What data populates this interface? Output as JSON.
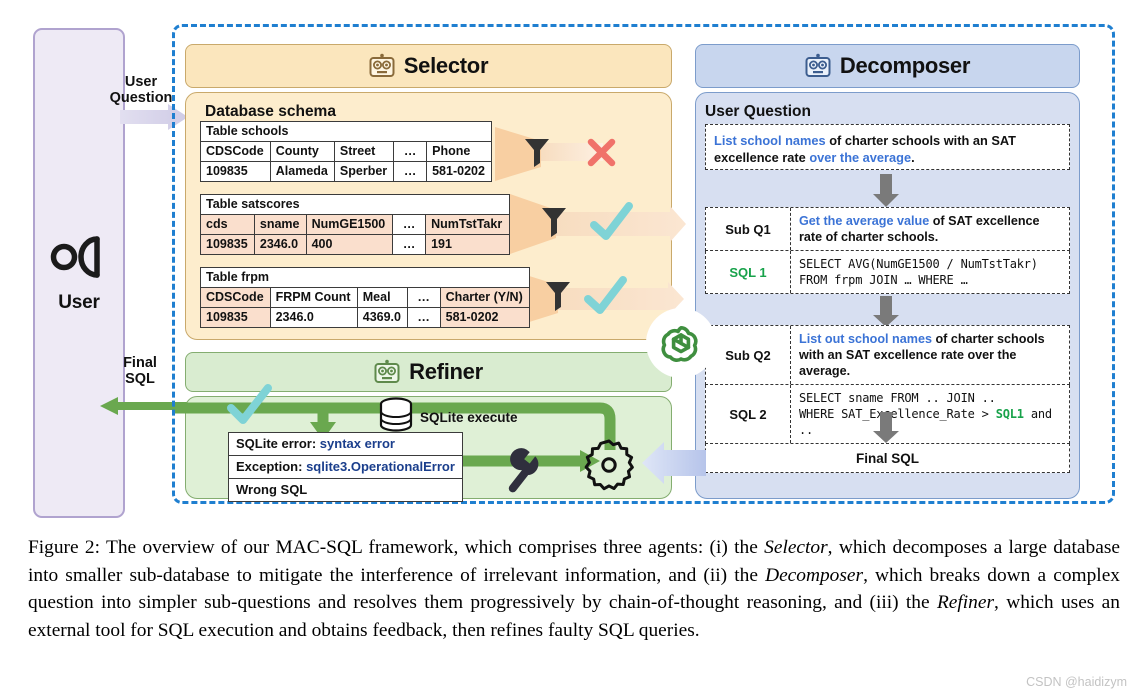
{
  "colors": {
    "framework_border": "#1f7fd0",
    "selector_bg": "#fdedcd",
    "selector_head_bg": "#fbe6bd",
    "decomposer_bg": "#d7dff1",
    "decomposer_head_bg": "#c8d6ee",
    "refiner_bg": "#dff0d6",
    "refiner_head_bg": "#d9ecd0",
    "user_bg": "#eeeaf5",
    "accent_green": "#6aa84f",
    "accent_blue": "#3b73d6",
    "check_teal": "#7fd3d6",
    "cross_red": "#f0726a",
    "sql_green": "#17a24a",
    "row_shade": "#fadfcd",
    "openai_green": "#3f8f3f"
  },
  "user": {
    "label": "User",
    "icon": "person-icon",
    "question_flow_label": "User\nQuestion",
    "question_flow_label_line1": "User",
    "question_flow_label_line2": "Question",
    "final_flow_label_line1": "Final",
    "final_flow_label_line2": "SQL"
  },
  "selector": {
    "title": "Selector",
    "icon": "robot-icon",
    "panel_title": "Database schema",
    "tables": [
      {
        "name": "Table schools",
        "shaded": false,
        "headers": [
          "CDSCode",
          "County",
          "Street",
          "…",
          "Phone"
        ],
        "row": [
          "109835",
          "Alameda",
          "Sperber",
          "…",
          "581-0202"
        ],
        "verdict": "cross",
        "shaded_cols": []
      },
      {
        "name": "Table satscores",
        "shaded": true,
        "headers": [
          "cds",
          "sname",
          "NumGE1500",
          "…",
          "NumTstTakr"
        ],
        "row": [
          "109835",
          "2346.0",
          "400",
          "…",
          "191"
        ],
        "verdict": "check",
        "shaded_cols": [
          0,
          1,
          2,
          4
        ]
      },
      {
        "name": "Table frpm",
        "shaded": true,
        "headers": [
          "CDSCode",
          "FRPM Count",
          "Meal",
          "…",
          "Charter (Y/N)"
        ],
        "row": [
          "109835",
          "2346.0",
          "4369.0",
          "…",
          "581-0202"
        ],
        "verdict": "check",
        "shaded_cols": [
          0,
          4
        ]
      }
    ],
    "filter_icon": "funnel-icon"
  },
  "decomposer": {
    "title": "Decomposer",
    "icon": "robot-icon",
    "panel_title": "User Question",
    "user_question": {
      "part1": "List school names",
      "part2": " of charter schools with an SAT excellence rate ",
      "part3": "over the average",
      "part4": "."
    },
    "steps": [
      {
        "label": "Sub Q1",
        "label_color": "black",
        "text_hl": "Get the average value",
        "text_rest": " of SAT excellence rate of charter schools."
      },
      {
        "label": "SQL 1",
        "label_color": "green",
        "code_line1": "SELECT AVG(NumGE1500 / NumTstTakr)",
        "code_line2": "FROM frpm JOIN … WHERE …"
      },
      {
        "label": "Sub Q2",
        "label_color": "black",
        "text_hl": "List out school names",
        "text_rest": " of charter schools with an SAT excellence rate over the average."
      },
      {
        "label": "SQL 2",
        "label_color": "black",
        "code_line1": "SELECT sname FROM .. JOIN ..",
        "code_line2_a": "WHERE SAT_Excellence_Rate > ",
        "code_line2_b": "SQL1",
        "code_line2_c": " and .."
      }
    ],
    "final_sql_label": "Final SQL"
  },
  "refiner": {
    "title": "Refiner",
    "icon": "robot-icon",
    "sqlite_execute_label": "SQLite execute",
    "db_icon": "database-icon",
    "gear_icon": "gear-icon",
    "wrench_icon": "wrench-icon",
    "errors": [
      {
        "key": "SQLite error:",
        "value": " syntax error"
      },
      {
        "key": "Exception:",
        "value": " sqlite3.OperationalError"
      },
      {
        "key": "Wrong SQL",
        "value": ""
      }
    ]
  },
  "caption": {
    "prefix": "Figure 2:",
    "text_1": " The overview of our MAC-SQL framework, which comprises three agents: (i) the ",
    "em_1": "Selector",
    "text_2": ", which decomposes a large database into smaller sub-database to mitigate the interference of irrelevant information, and (ii) the ",
    "em_2": "Decomposer",
    "text_3": ", which breaks down a complex question into simpler sub-questions and resolves them progressively by chain-of-thought reasoning, and (iii) the ",
    "em_3": "Refiner",
    "text_4": ", which uses an external tool for SQL execution and obtains feedback, then refines faulty SQL queries."
  },
  "watermark": "CSDN @haidizym"
}
